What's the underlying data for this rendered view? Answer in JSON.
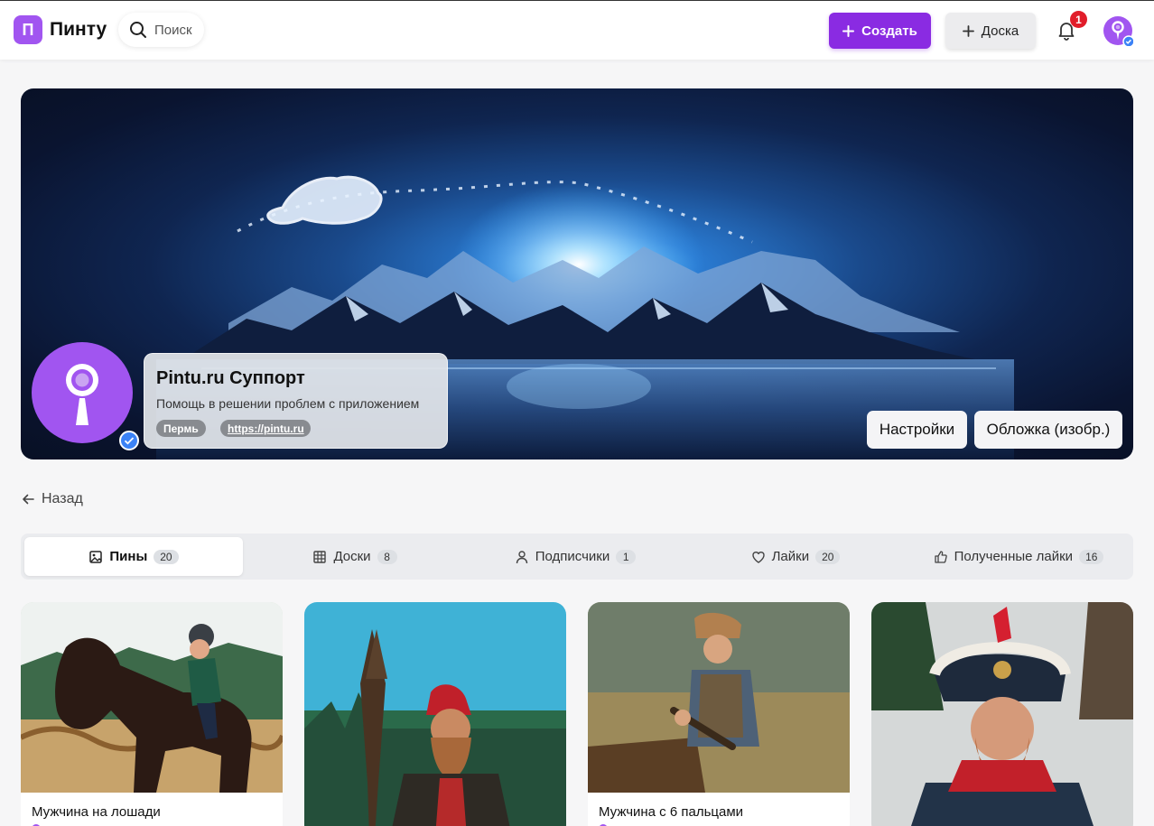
{
  "header": {
    "logo_letter": "П",
    "logo_text": "Пинту",
    "search_placeholder": "Поиск",
    "create_label": "Создать",
    "board_label": "Доска",
    "notifications_count": "1"
  },
  "profile": {
    "name": "Pintu.ru Суппорт",
    "description": "Помощь в решении проблем с приложением",
    "city": "Пермь",
    "link": "https://pintu.ru",
    "settings_label": "Настройки",
    "cover_label": "Обложка (изобр.)"
  },
  "back_label": "Назад",
  "tabs": [
    {
      "label": "Пины",
      "count": "20",
      "icon": "image-icon"
    },
    {
      "label": "Доски",
      "count": "8",
      "icon": "grid-icon"
    },
    {
      "label": "Подписчики",
      "count": "1",
      "icon": "user-icon"
    },
    {
      "label": "Лайки",
      "count": "20",
      "icon": "heart-icon"
    },
    {
      "label": "Полученные лайки",
      "count": "16",
      "icon": "thumbs-up-icon"
    }
  ],
  "pins": [
    {
      "title": "Мужчина на лошади"
    },
    {
      "title": ""
    },
    {
      "title": "Мужчина с 6 пальцами"
    },
    {
      "title": ""
    }
  ],
  "colors": {
    "accent": "#8a2be2",
    "logo": "#a155f0",
    "badge": "#e11d2a",
    "verified": "#3b82f6"
  }
}
